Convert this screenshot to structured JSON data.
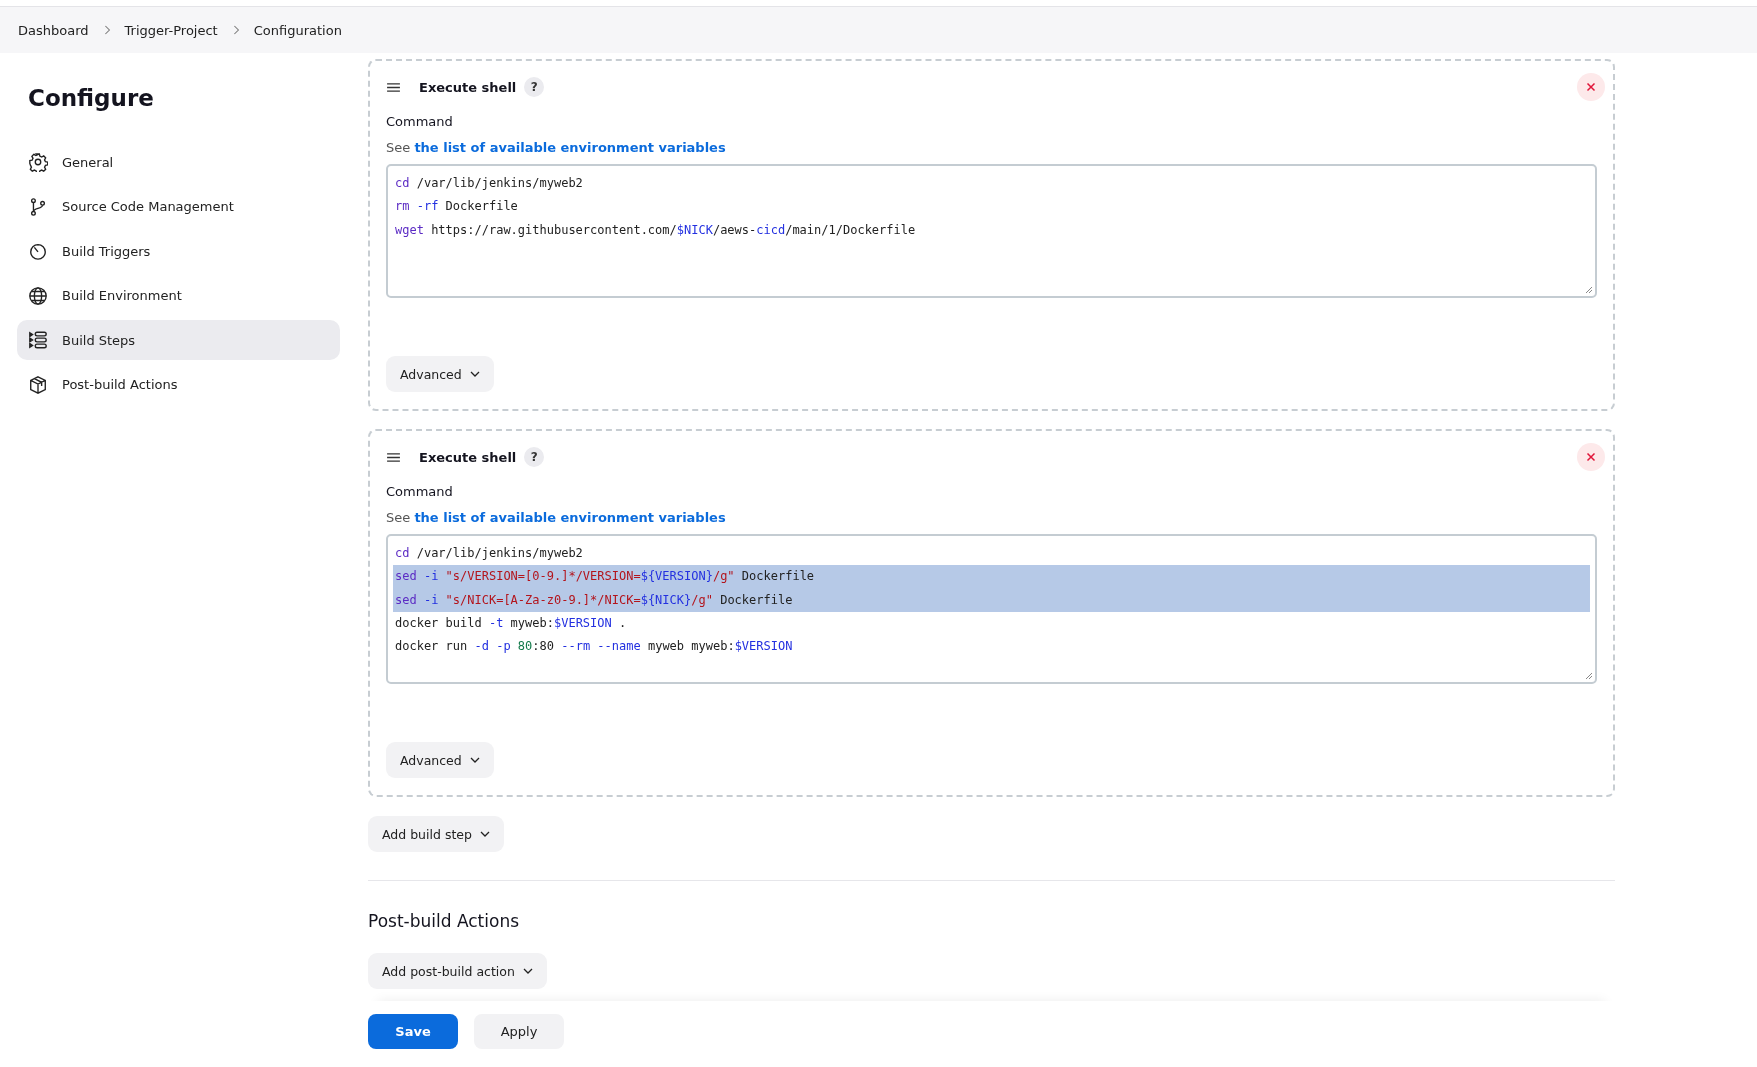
{
  "breadcrumbs": [
    {
      "label": "Dashboard"
    },
    {
      "label": "Trigger-Project"
    },
    {
      "label": "Configuration"
    }
  ],
  "sidebar": {
    "title": "Configure",
    "items": [
      {
        "label": "General",
        "selected": false
      },
      {
        "label": "Source Code Management",
        "selected": false
      },
      {
        "label": "Build Triggers",
        "selected": false
      },
      {
        "label": "Build Environment",
        "selected": false
      },
      {
        "label": "Build Steps",
        "selected": true
      },
      {
        "label": "Post-build Actions",
        "selected": false
      }
    ]
  },
  "build_steps": [
    {
      "title": "Execute shell",
      "help": "?",
      "field_label": "Command",
      "hint": "See",
      "hint_link": "the list of available environment variables",
      "advanced_button": "Advanced",
      "lines": [
        {
          "selected": false,
          "tokens": [
            {
              "text": "cd",
              "kind": "keyword"
            },
            {
              "text": " /var/lib/jenkins/myweb2",
              "kind": "plain"
            }
          ]
        },
        {
          "selected": false,
          "tokens": [
            {
              "text": "rm",
              "kind": "keyword"
            },
            {
              "text": " -rf",
              "kind": "option"
            },
            {
              "text": " Dockerfile",
              "kind": "plain"
            }
          ]
        },
        {
          "selected": false,
          "tokens": [
            {
              "text": "wget",
              "kind": "keyword"
            },
            {
              "text": " https://raw.githubusercontent.com/",
              "kind": "plain"
            },
            {
              "text": "$NICK",
              "kind": "variable"
            },
            {
              "text": "/aews-",
              "kind": "plain"
            },
            {
              "text": "cicd",
              "kind": "option"
            },
            {
              "text": "/main/1/Dockerfile",
              "kind": "plain"
            }
          ]
        }
      ]
    },
    {
      "title": "Execute shell",
      "help": "?",
      "field_label": "Command",
      "hint": "See",
      "hint_link": "the list of available environment variables",
      "advanced_button": "Advanced",
      "lines": [
        {
          "selected": false,
          "tokens": [
            {
              "text": "cd",
              "kind": "keyword"
            },
            {
              "text": " /var/lib/jenkins/myweb2",
              "kind": "plain"
            }
          ]
        },
        {
          "selected": true,
          "tokens": [
            {
              "text": "sed",
              "kind": "keyword"
            },
            {
              "text": " -i",
              "kind": "option"
            },
            {
              "text": " \"s/VERSION=[0-9.]*/VERSION=",
              "kind": "string"
            },
            {
              "text": "${VERSION}",
              "kind": "variable"
            },
            {
              "text": "/g\"",
              "kind": "string"
            },
            {
              "text": " Dockerfile",
              "kind": "plain"
            }
          ]
        },
        {
          "selected": true,
          "tokens": [
            {
              "text": "sed",
              "kind": "keyword"
            },
            {
              "text": " -i",
              "kind": "option"
            },
            {
              "text": " \"s/NICK=[A-Za-z0-9.]*/NICK=",
              "kind": "string"
            },
            {
              "text": "${NICK}",
              "kind": "variable"
            },
            {
              "text": "/g\"",
              "kind": "string"
            },
            {
              "text": " Dockerfile",
              "kind": "plain"
            }
          ]
        },
        {
          "selected": false,
          "tokens": [
            {
              "text": "docker build ",
              "kind": "plain"
            },
            {
              "text": "-t",
              "kind": "option"
            },
            {
              "text": " myweb:",
              "kind": "plain"
            },
            {
              "text": "$VERSION",
              "kind": "variable"
            },
            {
              "text": " .",
              "kind": "plain"
            }
          ]
        },
        {
          "selected": false,
          "tokens": [
            {
              "text": "docker run ",
              "kind": "plain"
            },
            {
              "text": "-d",
              "kind": "option"
            },
            {
              "text": " -p",
              "kind": "option"
            },
            {
              "text": " 80",
              "kind": "number"
            },
            {
              "text": ":80 ",
              "kind": "plain"
            },
            {
              "text": "--rm",
              "kind": "option"
            },
            {
              "text": " --name",
              "kind": "option"
            },
            {
              "text": " myweb myweb:",
              "kind": "plain"
            },
            {
              "text": "$VERSION",
              "kind": "variable"
            }
          ]
        }
      ]
    }
  ],
  "add_build_step": "Add build step",
  "post_build": {
    "heading": "Post-build Actions",
    "add_button": "Add post-build action"
  },
  "footer": {
    "save": "Save",
    "apply": "Apply"
  }
}
